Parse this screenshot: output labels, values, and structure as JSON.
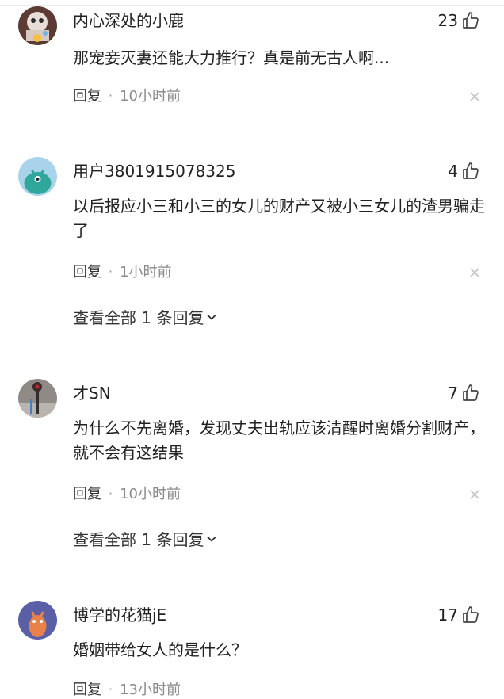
{
  "comments": [
    {
      "user": "内心深处的小鹿",
      "likes": "23",
      "text": "那宠妾灭妻还能大力推行？真是前无古人啊...",
      "reply_label": "回复",
      "separator": "·",
      "time": "10小时前"
    },
    {
      "user": "用户3801915078325",
      "likes": "4",
      "text": "以后报应小三和小三的女儿的财产又被小三女儿的渣男骗走了",
      "reply_label": "回复",
      "separator": "·",
      "time": "1小时前",
      "view_replies": "查看全部 1 条回复"
    },
    {
      "user": "才SN",
      "likes": "7",
      "text": "为什么不先离婚，发现丈夫出轨应该清醒时离婚分割财产，就不会有这结果",
      "reply_label": "回复",
      "separator": "·",
      "time": "10小时前",
      "view_replies": "查看全部 1 条回复"
    },
    {
      "user": "博学的花猫jE",
      "likes": "17",
      "text": "婚姻带给女人的是什么？",
      "reply_label": "回复",
      "separator": "·",
      "time": "13小时前"
    }
  ],
  "icons": {
    "like": "thumbs-up-icon",
    "dismiss": "close-icon",
    "expand": "chevron-down-icon"
  },
  "colors": {
    "text": "#222222",
    "meta": "#8a8a8a",
    "icon": "#444444",
    "dismiss": "#c4c4c4"
  }
}
